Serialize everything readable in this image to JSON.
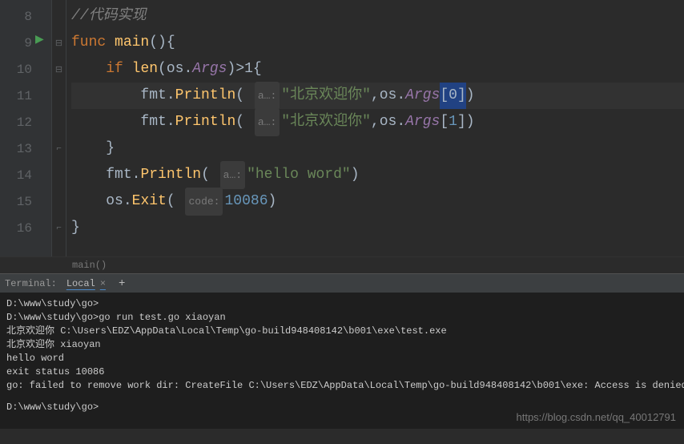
{
  "editor": {
    "lines": [
      {
        "num": "8"
      },
      {
        "num": "9"
      },
      {
        "num": "10"
      },
      {
        "num": "11"
      },
      {
        "num": "12"
      },
      {
        "num": "13"
      },
      {
        "num": "14"
      },
      {
        "num": "15"
      },
      {
        "num": "16"
      }
    ],
    "comment": "//代码实现",
    "kw_func": "func",
    "fn_main": "main",
    "kw_if": "if",
    "fn_len": "len",
    "pkg_os": "os",
    "prop_args": "Args",
    "gt1": ">1",
    "pkg_fmt": "fmt",
    "fn_println": "Println",
    "hint_a": "a…:",
    "str_bj": "\"北京欢迎你\"",
    "idx0": "0",
    "idx1": "1",
    "str_hello": "\"hello word\"",
    "fn_exit": "Exit",
    "hint_code": "code:",
    "num_10086": "10086",
    "breadcrumb": "main()"
  },
  "terminal": {
    "label": "Terminal:",
    "tab": "Local",
    "lines": {
      "l1": "D:\\www\\study\\go>",
      "l2": "D:\\www\\study\\go>go run test.go xiaoyan",
      "l3": "北京欢迎你 C:\\Users\\EDZ\\AppData\\Local\\Temp\\go-build948408142\\b001\\exe\\test.exe",
      "l4": "北京欢迎你 xiaoyan",
      "l5": "hello word",
      "l6": "exit status 10086",
      "l7": "go: failed to remove work dir: CreateFile C:\\Users\\EDZ\\AppData\\Local\\Temp\\go-build948408142\\b001\\exe: Access is denied.",
      "l8": "D:\\www\\study\\go>"
    }
  },
  "watermark": "https://blog.csdn.net/qq_40012791"
}
